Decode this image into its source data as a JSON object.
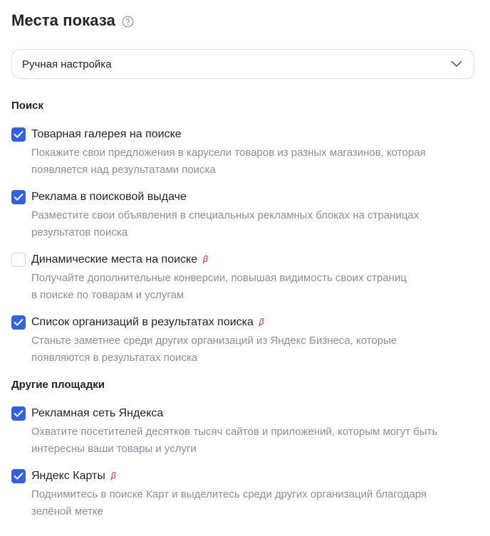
{
  "header": {
    "title": "Места показа",
    "help_icon": "question-circle-icon"
  },
  "placement_select": {
    "value": "Ручная настройка",
    "icon": "chevron-down-icon"
  },
  "sections": [
    {
      "title": "Поиск",
      "items": [
        {
          "label": "Товарная галерея на поиске",
          "checked": true,
          "beta": "",
          "desc1": "Покажите свои предложения в карусели товаров из разных магазинов, которая",
          "desc2": "появляется над результатами поиска"
        },
        {
          "label": "Реклама в поисковой выдаче",
          "checked": true,
          "beta": "",
          "desc1": "Разместите свои объявления в специальных рекламных блоках на страницах",
          "desc2": "результатов поиска"
        },
        {
          "label": "Динамические места на поиске",
          "checked": false,
          "beta": "β",
          "desc1": "Получайте дополнительные конверсии, повышая видимость своих страниц",
          "desc2": "в поиске по товарам и услугам"
        },
        {
          "label": "Список организаций в результатах поиска",
          "checked": true,
          "beta": "β",
          "desc1": "Станьте заметнее среди других организаций из Яндекс Бизнеса, которые",
          "desc2": "появляются в результатах поиска"
        }
      ]
    },
    {
      "title": "Другие площадки",
      "items": [
        {
          "label": "Рекламная сеть Яндекса",
          "checked": true,
          "beta": "",
          "desc1": "Охватите посетителей десятков тысяч сайтов и приложений, которым могут быть",
          "desc2": "интересны ваши товары и услуги"
        },
        {
          "label": "Яндекс Карты",
          "checked": true,
          "beta": "β",
          "desc1": "Поднимитесь в поиске Карт и выделитесь среди других организаций благодаря",
          "desc2": "зелёной метке"
        }
      ]
    }
  ],
  "colors": {
    "accent": "#3360e8",
    "beta": "#e11d1d",
    "muted": "#8a8f99"
  }
}
